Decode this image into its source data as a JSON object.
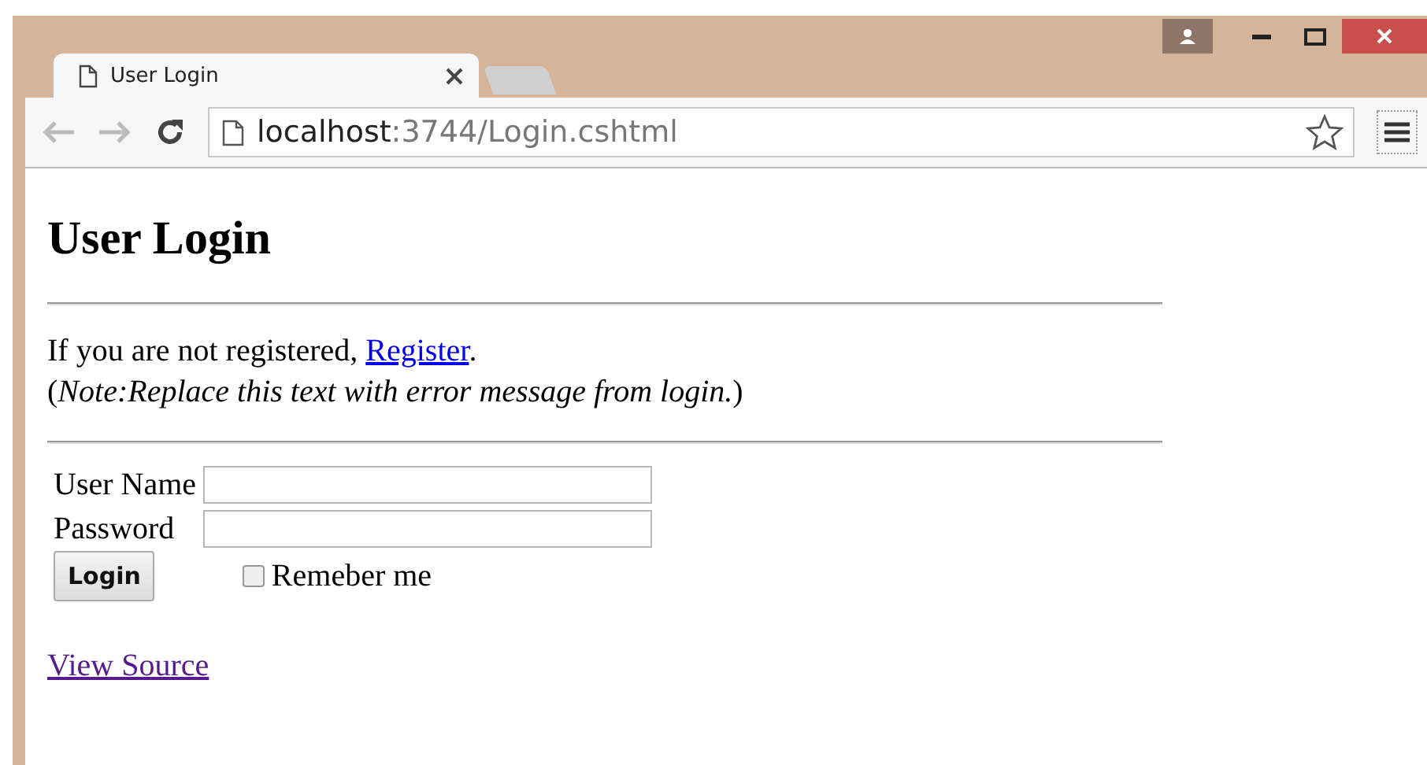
{
  "browser": {
    "tab": {
      "title": "User Login",
      "selected": true
    },
    "address": {
      "host": "localhost",
      "path": ":3744/Login.cshtml"
    }
  },
  "page": {
    "heading": "User Login",
    "register": {
      "before": "If you are not registered, ",
      "link": "Register",
      "after": "."
    },
    "note": "(*Note:Replace this text with error message from login.*)",
    "fields": [
      {
        "label": "User Name"
      },
      {
        "label": "Password"
      }
    ],
    "login_button": "Login",
    "remember": {
      "label": "Remeber me",
      "checked": false
    },
    "view_source": "View Source"
  }
}
